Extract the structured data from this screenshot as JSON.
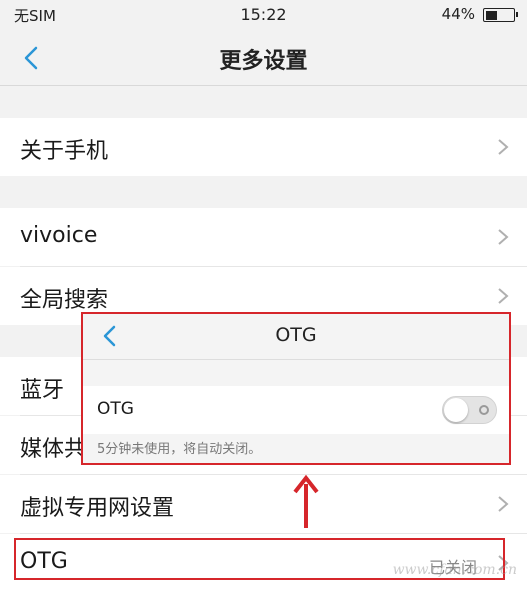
{
  "status_bar": {
    "carrier": "无SIM",
    "time": "15:22",
    "battery_percent": "44%",
    "battery_level": 0.44
  },
  "nav": {
    "back_icon": "chevron-left-icon",
    "title": "更多设置"
  },
  "items": [
    {
      "label": "关于手机"
    },
    {
      "label": "vivoice"
    },
    {
      "label": "全局搜索"
    },
    {
      "label": "蓝牙"
    },
    {
      "label": "媒体共"
    },
    {
      "label": "虚拟专用网设置"
    },
    {
      "label": "OTG",
      "value": "已关闭"
    }
  ],
  "otg_popup": {
    "title": "OTG",
    "toggle_label": "OTG",
    "toggle_on": false,
    "hint": "5分钟未使用，将自动关闭。"
  },
  "annotation_color": "#d6262b",
  "accent_color": "#2b96d6",
  "watermark": "www.cfan.com.cn"
}
